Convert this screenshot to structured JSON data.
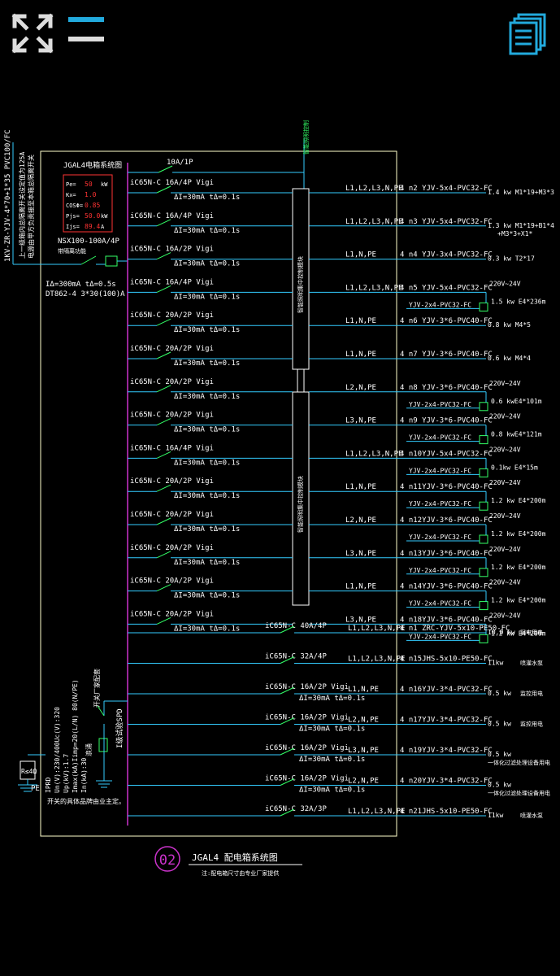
{
  "colors": {
    "background": "#000000",
    "text": "#ffffff",
    "frame": "#ffffcc",
    "busbar": "#cc33cc",
    "feeder": "#33ccff",
    "accent": "#33ff66",
    "red": "#ff3333",
    "toolbar_icon": "#dddddd",
    "toolbar_blue": "#22aadd"
  },
  "toolbar": {
    "fullscreen_icon": "expand-arrows-icon",
    "layers_icon": "layers-toggle-icon",
    "pages_icon": "document-pages-icon"
  },
  "incoming": {
    "cable_label": "1KV-ZR-YJV-4*70+1*35 PVC100/FC",
    "note_line1": "上一级箱内总隔离开关设定值为125A",
    "note_line2": "电源由甲方负责接至本箱总隔离开关"
  },
  "panel": {
    "title": "JGAL4电箱系统图",
    "params": [
      {
        "key": "Pe=",
        "value": "50",
        "unit": "kW"
      },
      {
        "key": "Kx=",
        "value": "1.0",
        "unit": ""
      },
      {
        "key": "COSΦ=",
        "value": "0.85",
        "unit": ""
      },
      {
        "key": "Pjs=",
        "value": "50.0",
        "unit": "kW"
      },
      {
        "key": "Ijs=",
        "value": "89.4",
        "unit": "A"
      }
    ],
    "main_breaker": "NSX100-100A/4P",
    "main_breaker_note": "带隔离功能",
    "rcd_setting": "IΔ=300mA tΔ=0.5s",
    "meter": "DT862-4 3*30(100)A",
    "top_breaker": "10A/1P",
    "lighting_label": "智能照明控制",
    "module_upper": "智能照明集中控制模块",
    "module_lower": "智能照明集中控制模块"
  },
  "circuits": [
    {
      "breaker": "iC65N-C 16A/4P Vigi",
      "rcd": "ΔI=30mA tΔ=0.1s",
      "phase": "L1,L2,L3,N,PE",
      "cable": "4 n2 YJV-5x4-PVC32-FC",
      "load": "1.4 kw M1*19+M3*3",
      "load2": ""
    },
    {
      "breaker": "iC65N-C 16A/4P Vigi",
      "rcd": "ΔI=30mA tΔ=0.1s",
      "phase": "L1,L2,L3,N,PE",
      "cable": "4 n3 YJV-5x4-PVC32-FC",
      "load": "1.3 kw M1*19+B1*4",
      "load2": "+M3*3+X1*"
    },
    {
      "breaker": "iC65N-C 16A/2P Vigi",
      "rcd": "ΔI=30mA tΔ=0.1s",
      "phase": "L1,N,PE",
      "cable": "4 n4 YJV-3x4-PVC32-FC",
      "load": "0.3 kw  T2*17",
      "load2": ""
    },
    {
      "breaker": "iC65N-C 16A/4P Vigi",
      "rcd": "ΔI=30mA tΔ=0.1s",
      "phase": "L1,L2,L3,N,PE",
      "cable": "4 n5 YJV-5x4-PVC32-FC",
      "load": "1.5 kw E4*236m",
      "load2": "220V~24V",
      "sub": "YJV-2x4-PVC32-FC"
    },
    {
      "breaker": "iC65N-C 20A/2P Vigi",
      "rcd": "ΔI=30mA tΔ=0.1s",
      "phase": "L1,N,PE",
      "cable": "4 n6 YJV-3*6-PVC40-FC",
      "load": "0.8 kw   M4*5",
      "load2": ""
    },
    {
      "breaker": "iC65N-C 20A/2P Vigi",
      "rcd": "ΔI=30mA tΔ=0.1s",
      "phase": "L1,N,PE",
      "cable": "4 n7 YJV-3*6-PVC40-FC",
      "load": "0.6 kw   M4*4",
      "load2": ""
    },
    {
      "breaker": "iC65N-C 20A/2P Vigi",
      "rcd": "ΔI=30mA tΔ=0.1s",
      "phase": "L2,N,PE",
      "cable": "4 n8 YJV-3*6-PVC40-FC",
      "load": "0.6 kwE4*101m",
      "load2": "220V~24V",
      "sub": "YJV-2x4-PVC32-FC"
    },
    {
      "breaker": "iC65N-C 20A/2P Vigi",
      "rcd": "ΔI=30mA tΔ=0.1s",
      "phase": "L3,N,PE",
      "cable": "4 n9 YJV-3*6-PVC40-FC",
      "load": "0.8 kwE4*121m",
      "load2": "220V~24V",
      "sub": "YJV-2x4-PVC32-FC"
    },
    {
      "breaker": "iC65N-C 16A/4P Vigi",
      "rcd": "ΔI=30mA tΔ=0.1s",
      "phase": "L1,L2,L3,N,PE",
      "cable": "4 n10YJV-5x4-PVC32-FC",
      "load": "0.1kw E4*15m",
      "load2": "220V~24V",
      "sub": "YJV-2x4-PVC32-FC"
    },
    {
      "breaker": "iC65N-C 20A/2P Vigi",
      "rcd": "ΔI=30mA tΔ=0.1s",
      "phase": "L1,N,PE",
      "cable": "4 n11YJV-3*6-PVC40-FC",
      "load": "1.2 kw E4*200m",
      "load2": "220V~24V",
      "sub": "YJV-2x4-PVC32-FC"
    },
    {
      "breaker": "iC65N-C 20A/2P Vigi",
      "rcd": "ΔI=30mA tΔ=0.1s",
      "phase": "L2,N,PE",
      "cable": "4 n12YJV-3*6-PVC40-FC",
      "load": "1.2 kw E4*200m",
      "load2": "220V~24V",
      "sub": "YJV-2x4-PVC32-FC"
    },
    {
      "breaker": "iC65N-C 20A/2P Vigi",
      "rcd": "ΔI=30mA tΔ=0.1s",
      "phase": "L3,N,PE",
      "cable": "4 n13YJV-3*6-PVC40-FC",
      "load": "1.2 kw E4*200m",
      "load2": "220V~24V",
      "sub": "YJV-2x4-PVC32-FC"
    },
    {
      "breaker": "iC65N-C 20A/2P Vigi",
      "rcd": "ΔI=30mA tΔ=0.1s",
      "phase": "L1,N,PE",
      "cable": "4 n14YJV-3*6-PVC40-FC",
      "load": "1.2 kw E4*200m",
      "load2": "220V~24V",
      "sub": "YJV-2x4-PVC32-FC"
    },
    {
      "breaker": "iC65N-C 20A/2P Vigi",
      "rcd": "ΔI=30mA tΔ=0.1s",
      "phase": "L3,N,PE",
      "cable": "4 n18YJV-3*6-PVC40-FC",
      "load": "1.2 kw E4*200m",
      "load2": "220V~24V",
      "sub": "YJV-2x4-PVC32-FC"
    }
  ],
  "power_circuits": [
    {
      "breaker": "iC65N-C 40A/4P",
      "rcd": "",
      "phase": "L1,L2,L3,N,PE",
      "cable": "4 n1 ZRC-YJV-5x10-PE50-FC",
      "load": "10.0 kw",
      "desc": "弱电用电"
    },
    {
      "breaker": "iC65N-C 32A/4P",
      "rcd": "",
      "phase": "L1,L2,L3,N,PE",
      "cable": "4 n15JHS-5x10-PE50-FC",
      "load": "11kw",
      "desc": "喷灌水泵"
    },
    {
      "breaker": "iC65N-C 16A/2P Vigi",
      "rcd": "ΔI=30mA tΔ=0.1s",
      "phase": "L1,N,PE",
      "cable": "4 n16YJV-3*4-PVC32-FC",
      "load": "0.5 kw",
      "desc": "监控用电"
    },
    {
      "breaker": "iC65N-C 16A/2P Vigi",
      "rcd": "ΔI=30mA tΔ=0.1s",
      "phase": "L2,N,PE",
      "cable": "4 n17YJV-3*4-PVC32-FC",
      "load": "0.5 kw",
      "desc": "监控用电"
    },
    {
      "breaker": "iC65N-C 16A/2P Vigi",
      "rcd": "ΔI=30mA tΔ=0.1s",
      "phase": "L3,N,PE",
      "cable": "4 n19YJV-3*4-PVC32-FC",
      "load": "0.5 kw",
      "desc": "一体化过滤处理设备用电"
    },
    {
      "breaker": "iC65N-C 16A/2P Vigi",
      "rcd": "ΔI=30mA tΔ=0.1s",
      "phase": "L2,N,PE",
      "cable": "4 n20YJV-3*4-PVC32-FC",
      "load": "0.5 kw",
      "desc": "一体化过滤处理设备用电"
    },
    {
      "breaker": "iC65N-C 32A/3P",
      "rcd": "",
      "phase": "L1,L2,L3,N,PE",
      "cable": "4 n21JHS-5x10-PE50-FC",
      "load": "11kw",
      "desc": "喷灌水泵"
    }
  ],
  "spd": {
    "label": "I级试验SPD",
    "switch_note": "开关厂家配套",
    "specs": [
      "IPRD",
      "Un(V):230/400Uc(V):320",
      "Up(kV):1.7 ",
      "Imax(kA)Iimp=20(L/N) 80(N/PE)",
      "In(kA):30 "
    ],
    "note": "开关的具体品牌由业主定。",
    "spd_type_note": "浪涌",
    "grounding": "R≤4Ω",
    "pe": "PE"
  },
  "footer": {
    "number": "02",
    "title": "JGAL4 配电箱系统图",
    "note": "注:配电箱尺寸由专业厂家提供"
  }
}
